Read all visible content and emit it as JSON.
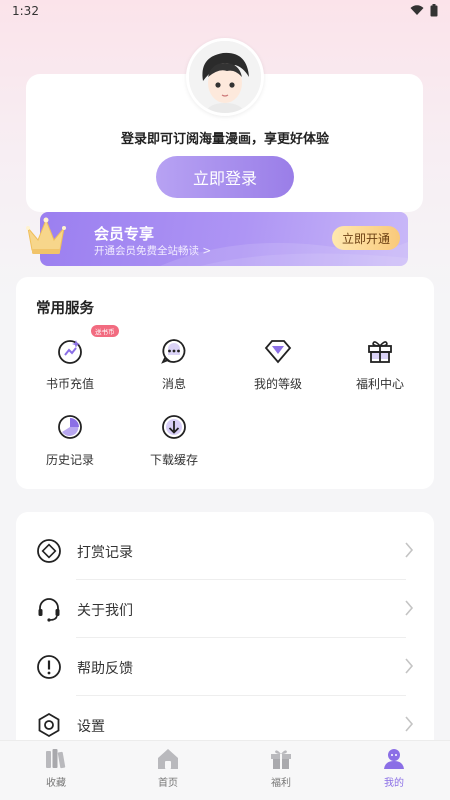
{
  "status_bar": {
    "time": "1:32"
  },
  "profile": {
    "login_tip": "登录即可订阅海量漫画，享更好体验",
    "login_button": "立即登录"
  },
  "vip": {
    "title": "会员专享",
    "subtitle": "开通会员免费全站畅读 >",
    "button": "立即开通"
  },
  "services": {
    "title": "常用服务",
    "items": [
      {
        "label": "书币充值",
        "icon": "coin-recharge-icon",
        "badge": "送书币"
      },
      {
        "label": "消息",
        "icon": "message-icon"
      },
      {
        "label": "我的等级",
        "icon": "level-icon"
      },
      {
        "label": "福利中心",
        "icon": "gift-icon"
      },
      {
        "label": "历史记录",
        "icon": "history-icon"
      },
      {
        "label": "下载缓存",
        "icon": "download-icon"
      }
    ]
  },
  "menu": {
    "items": [
      {
        "label": "打赏记录",
        "icon": "reward-icon"
      },
      {
        "label": "关于我们",
        "icon": "headset-icon"
      },
      {
        "label": "帮助反馈",
        "icon": "help-icon"
      },
      {
        "label": "设置",
        "icon": "settings-icon"
      }
    ]
  },
  "tabbar": {
    "items": [
      {
        "label": "收藏",
        "icon": "bookshelf-icon"
      },
      {
        "label": "首页",
        "icon": "home-icon"
      },
      {
        "label": "福利",
        "icon": "gift-tab-icon"
      },
      {
        "label": "我的",
        "icon": "profile-tab-icon",
        "active": true
      }
    ]
  },
  "colors": {
    "accent": "#9a7ee8",
    "badge": "#f26b80",
    "vip_button": "#f9c97a"
  }
}
